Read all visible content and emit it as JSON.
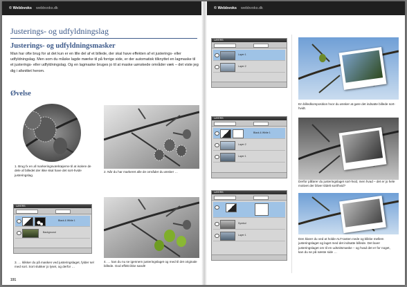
{
  "header": {
    "left_brand": "© Webbvoks",
    "left_url": "webbvoks.dk",
    "right_brand": "© Webbvoks",
    "right_url": "webbvoks.dk"
  },
  "chapter_title": "Justerings- og udfyldningslag",
  "section_heading": "Justerings- og udfyldningsmasker",
  "intro_text": "Man har ofte brug for at det kun er en lille del af et billede, der skal have effekten af et justerings- eller udfyldningslag. Men som du måske lagde mærke til på forrige side, er der automatisk tilknyttet en lagmaske til et justerings- eller udfyldningslag. Og en lagmaske bruges jo til at maske uønskede områder væk – det viste jeg dig i afsnittet herom.",
  "exercise_heading": "Øvelse",
  "captions": {
    "step1": "1. Brug fx en af markeringsværktøjerne til at isolere de dele af billedet der ikke skal have det sort-hvide justeringslag.",
    "step2": "2. Når du har markeret alle de områder du ønsker …",
    "step3": "3. … klikker du på masken ved justeringslaget, fylder sel med sort. Sort slukker jo lyset, og derfor …",
    "step4": "4. … kan du nu se igennem justeringslaget og med til det originale billede. God effekt ikke sandt!",
    "right1": "En billedkomposition hvor du ønsker at gøre det indsatte billede sort-hvidt.",
    "right2": "Derfor påfører du justeringslaget sort-hvid, men hvad – det er jo hele motivet der bliver tildelt sort/hvid?",
    "right3": "Den klarer du ved at holde ALT-tasten nede og klikke mellem justeringslaget og laget med det indsatte billede. Det laver justeringslaget om til en udsnitsmaske – og hvad det er for noget, kan du se på næste side …"
  },
  "panels": {
    "title": "LAYERS",
    "layer_bw": "Black & White 1",
    "layer_layer1": "Layer 1",
    "layer_layer2": "Layer 2",
    "layer_bg": "Background",
    "layer_symbol": "Symbol"
  },
  "page_number": "191",
  "colors": {
    "accent": "#3d5a8a",
    "bar": "#1f1f1f",
    "selection": "#9fc3e6",
    "olive_green": "#7fae2a"
  }
}
